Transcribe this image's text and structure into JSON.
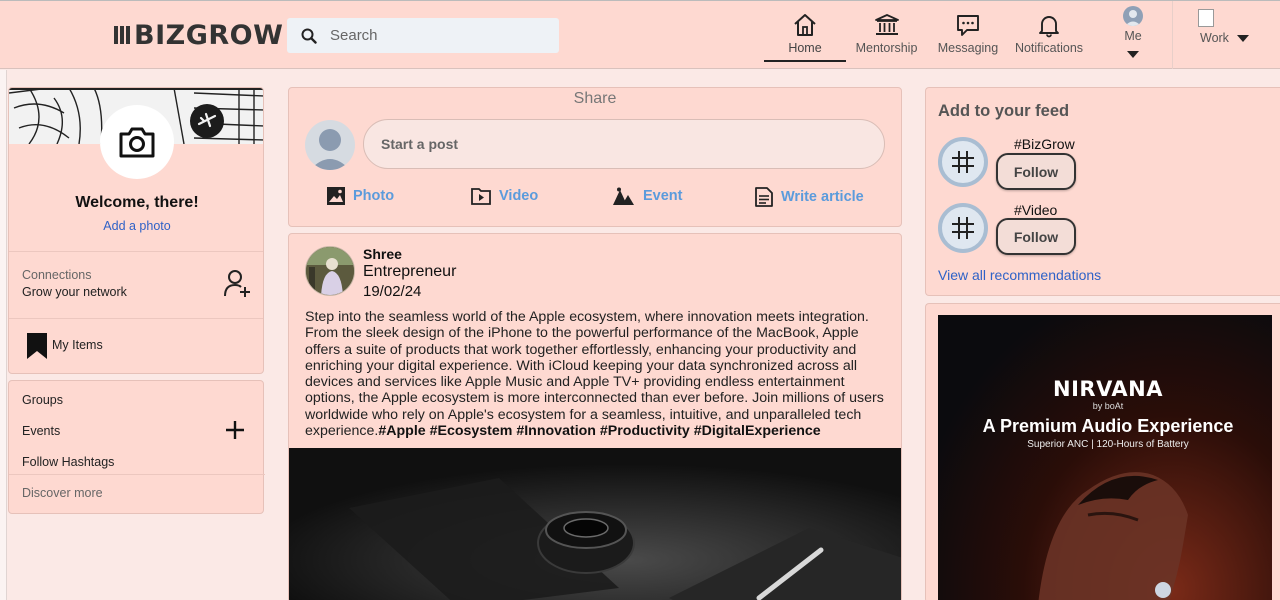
{
  "header": {
    "logo_text": "BIZGROW",
    "search_placeholder": "Search",
    "nav": {
      "home": "Home",
      "mentorship": "Mentorship",
      "messaging": "Messaging",
      "notifications": "Notifications",
      "me": "Me",
      "work": "Work"
    }
  },
  "profile": {
    "welcome": "Welcome, there!",
    "add_photo": "Add a photo",
    "connections_label": "Connections",
    "connections_sub": "Grow your network",
    "my_items": "My Items"
  },
  "links": {
    "groups": "Groups",
    "events": "Events",
    "follow_hashtags": "Follow Hashtags",
    "discover_more": "Discover more"
  },
  "share": {
    "title": "Share",
    "placeholder": "Start a post",
    "actions": {
      "photo": "Photo",
      "video": "Video",
      "event": "Event",
      "article": "Write article"
    }
  },
  "post": {
    "author": "Shree",
    "role": "Entrepreneur",
    "date": "19/02/24",
    "text": "Step into the seamless world of the Apple ecosystem, where innovation meets integration. From the sleek design of the iPhone to the powerful performance of the MacBook, Apple offers a suite of products that work together effortlessly, enhancing your productivity and enriching your digital experience. With iCloud keeping your data synchronized across all devices and services like Apple Music and Apple TV+ providing endless entertainment options, the Apple ecosystem is more interconnected than ever before. Join millions of users worldwide who rely on Apple's ecosystem for a seamless, intuitive, and unparalleled tech experience.",
    "hashtags": "#Apple #Ecosystem #Innovation #Productivity #DigitalExperience"
  },
  "feed": {
    "title": "Add to your feed",
    "tags": [
      {
        "name": "#BizGrow",
        "button": "Follow"
      },
      {
        "name": "#Video",
        "button": "Follow"
      }
    ],
    "view_all": "View all recommendations"
  },
  "ad": {
    "brand": "NIRVANA",
    "byline": "by boAt",
    "headline": "A Premium Audio Experience",
    "sub": "Superior ANC | 120-Hours of Battery"
  },
  "colors": {
    "header_bg": "#fed9d1",
    "card_bg": "#fed9d1",
    "page_bg": "#fbe9e6",
    "link_blue": "#2f62c7",
    "action_blue": "#5b9bdc"
  }
}
